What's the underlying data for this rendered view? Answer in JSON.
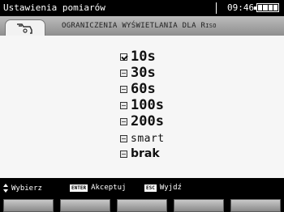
{
  "statusbar": {
    "title": "Ustawienia pomiarów",
    "time": "09:46",
    "battery_icon": "battery-icon"
  },
  "header": {
    "tool_icon": "probe-clip-icon",
    "title_main": "OGRANICZENIA WYŚWIETLANIA DLA R",
    "title_sub": "ISO"
  },
  "options": [
    {
      "label": "10s",
      "checked": true
    },
    {
      "label": "30s",
      "checked": false
    },
    {
      "label": "60s",
      "checked": false
    },
    {
      "label": "100s",
      "checked": false
    },
    {
      "label": "200s",
      "checked": false
    },
    {
      "label": "smart",
      "checked": false
    },
    {
      "label": "brak",
      "checked": false
    }
  ],
  "footer": {
    "select_label": "Wybierz",
    "enter_key": "ENTER",
    "accept_label": "Akceptuj",
    "esc_key": "ESC",
    "exit_label": "Wyjdź"
  }
}
